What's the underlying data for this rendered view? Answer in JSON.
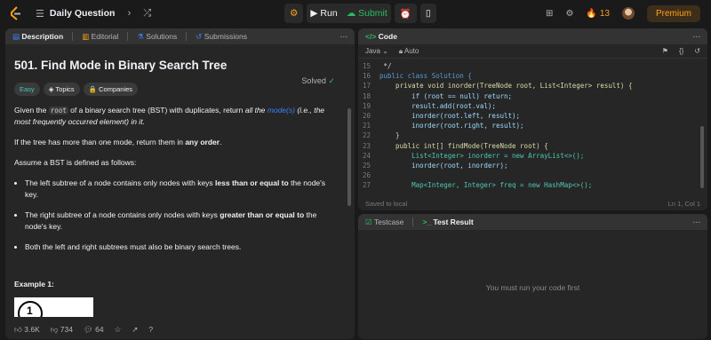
{
  "topbar": {
    "problem_list_label": "Daily Question",
    "run_label": "Run",
    "submit_label": "Submit",
    "streak_count": "13",
    "premium_label": "Premium"
  },
  "description_panel": {
    "tabs": [
      {
        "label": "Description"
      },
      {
        "label": "Editorial"
      },
      {
        "label": "Solutions"
      },
      {
        "label": "Submissions"
      }
    ],
    "title": "501. Find Mode in Binary Search Tree",
    "status": "Solved",
    "difficulty": "Easy",
    "tag_topics": "Topics",
    "tag_companies": "Companies",
    "intro_part1": "Given the ",
    "intro_code": "root",
    "intro_part2": " of a binary search tree (BST) with duplicates, return ",
    "intro_italic1": "all the ",
    "intro_link": "mode(s)",
    "intro_italic2": " (i.e., the most frequently occurred element) in it.",
    "multi_part1": "If the tree has more than one mode, return them in ",
    "multi_bold": "any order",
    "multi_part2": ".",
    "assume": "Assume a BST is defined as follows:",
    "bullet1_part1": "The left subtree of a node contains only nodes with keys ",
    "bullet1_bold": "less than or equal to",
    "bullet1_part2": " the node's key.",
    "bullet2_part1": "The right subtree of a node contains only nodes with keys ",
    "bullet2_bold": "greater than or equal to",
    "bullet2_part2": " the node's key.",
    "bullet3": "Both the left and right subtrees must also be binary search trees.",
    "example_title": "Example 1:",
    "example_node": "1",
    "likes": "3.6K",
    "dislikes": "734",
    "comments": "64"
  },
  "code_panel": {
    "tab_label": "Code",
    "language": "Java",
    "mode": "Auto",
    "saved_status": "Saved to local",
    "cursor": "Ln 1, Col 1",
    "lines": [
      {
        "n": "15",
        "text": " */"
      },
      {
        "n": "16",
        "text": "public class Solution {"
      },
      {
        "n": "17",
        "text": "    private void inorder(TreeNode root, List<Integer> result) {"
      },
      {
        "n": "18",
        "text": "        if (root == null) return;"
      },
      {
        "n": "19",
        "text": "        result.add(root.val);"
      },
      {
        "n": "20",
        "text": "        inorder(root.left, result);"
      },
      {
        "n": "21",
        "text": "        inorder(root.right, result);"
      },
      {
        "n": "22",
        "text": "    }"
      },
      {
        "n": "23",
        "text": "    public int[] findMode(TreeNode root) {"
      },
      {
        "n": "24",
        "text": "        List<Integer> inorderr = new ArrayList<>();"
      },
      {
        "n": "25",
        "text": "        inorder(root, inorderr);"
      },
      {
        "n": "26",
        "text": ""
      },
      {
        "n": "27",
        "text": "        Map<Integer, Integer> freq = new HashMap<>();"
      }
    ]
  },
  "test_panel": {
    "tab_testcase": "Testcase",
    "tab_result": "Test Result",
    "message": "You must run your code first"
  }
}
